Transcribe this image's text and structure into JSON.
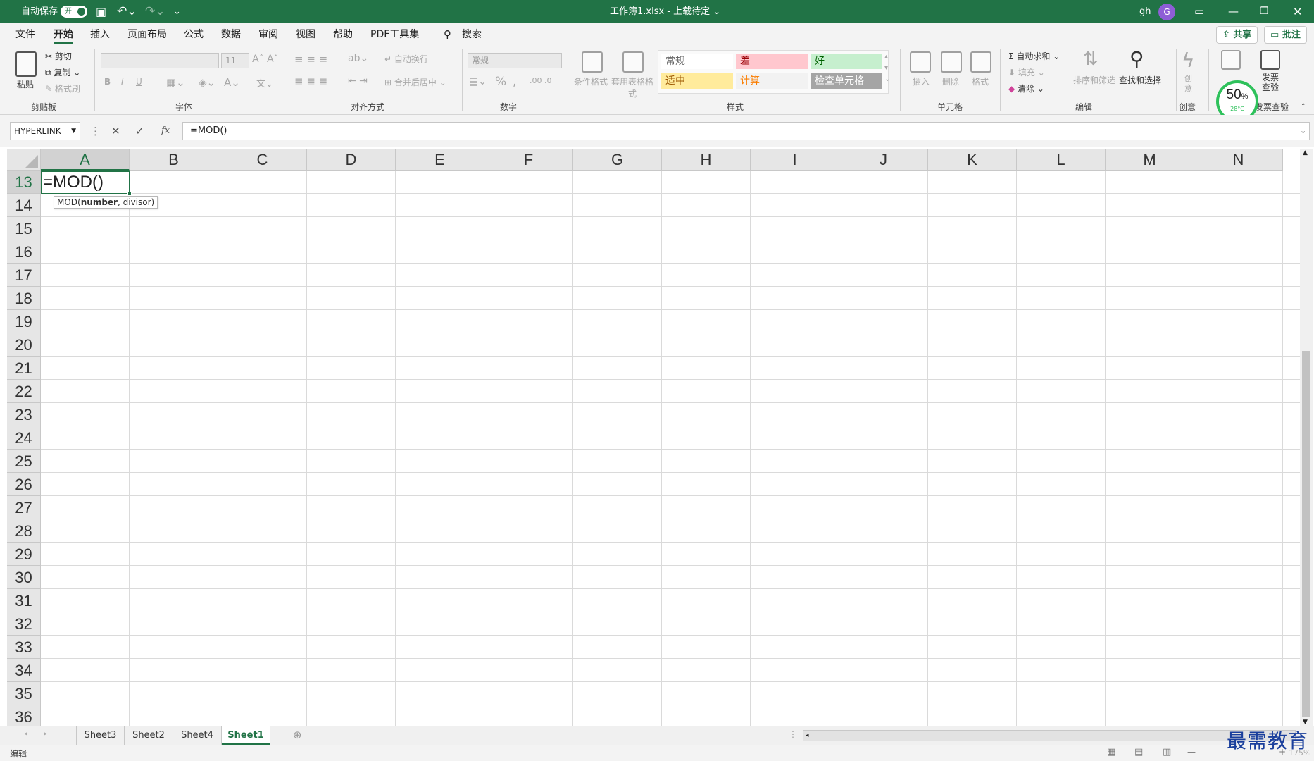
{
  "titlebar": {
    "autosave_label": "自动保存",
    "autosave_toggle": "开",
    "doc_title": "工作簿1.xlsx - 上载待定 ⌄",
    "user_name": "gh",
    "user_initial": "G"
  },
  "menu": {
    "tabs": [
      "文件",
      "开始",
      "插入",
      "页面布局",
      "公式",
      "数据",
      "审阅",
      "视图",
      "帮助",
      "PDF工具集"
    ],
    "active": "开始",
    "search": "搜索",
    "share": "共享",
    "comment": "批注"
  },
  "ribbon": {
    "clipboard": {
      "paste": "粘贴",
      "cut": "剪切",
      "copy": "复制",
      "format_painter": "格式刷",
      "label": "剪贴板"
    },
    "font": {
      "size": "11",
      "label": "字体",
      "bold": "B",
      "italic": "I",
      "underline": "U"
    },
    "alignment": {
      "wrap": "自动换行",
      "merge": "合并后居中",
      "label": "对齐方式"
    },
    "number": {
      "format": "常规",
      "label": "数字"
    },
    "styles": {
      "conditional": "条件格式",
      "table": "套用表格格式",
      "cells": [
        {
          "text": "常规",
          "bg": "#ffffff",
          "color": "#666666"
        },
        {
          "text": "差",
          "bg": "#ffc7ce",
          "color": "#9c0006"
        },
        {
          "text": "好",
          "bg": "#c6efce",
          "color": "#006100"
        },
        {
          "text": "适中",
          "bg": "#ffeb9c",
          "color": "#9c5700"
        },
        {
          "text": "计算",
          "bg": "#f2f2f2",
          "color": "#fa7d00"
        },
        {
          "text": "检查单元格",
          "bg": "#a5a5a5",
          "color": "#ffffff"
        }
      ],
      "label": "样式"
    },
    "cells_group": {
      "insert": "插入",
      "delete": "删除",
      "format": "格式",
      "label": "单元格"
    },
    "editing": {
      "autosum": "自动求和",
      "fill": "填充",
      "clear": "清除",
      "sort": "排序和筛选",
      "find": "查找和选择",
      "label": "编辑"
    },
    "creative": {
      "label": "创意",
      "btn": "创意"
    },
    "invoice": {
      "btn": "发票查验",
      "label": "发票查验"
    },
    "gauge": {
      "percent": "50",
      "temp": "28°C"
    }
  },
  "formula_bar": {
    "name_box": "HYPERLINK",
    "cancel": "✕",
    "enter": "✓",
    "fx": "fx",
    "formula": "=MOD()"
  },
  "grid": {
    "columns": [
      "A",
      "B",
      "C",
      "D",
      "E",
      "F",
      "G",
      "H",
      "I",
      "J",
      "K",
      "L",
      "M",
      "N"
    ],
    "rows": [
      "13",
      "14",
      "15",
      "16",
      "17",
      "18",
      "19",
      "20",
      "21",
      "22",
      "23",
      "24",
      "25",
      "26",
      "27",
      "28",
      "29",
      "30",
      "31",
      "32",
      "33",
      "34",
      "35",
      "36"
    ],
    "selected_column": "A",
    "selected_row": "13",
    "active_cell_value": "=MOD()",
    "tooltip_fn": "MOD(",
    "tooltip_arg1": "number",
    "tooltip_rest": ", divisor)"
  },
  "sheets": {
    "tabs": [
      "Sheet3",
      "Sheet2",
      "Sheet4",
      "Sheet1"
    ],
    "active": "Sheet1"
  },
  "status": {
    "mode": "编辑",
    "zoom": "175%"
  },
  "watermark": "最需教育",
  "colors": {
    "accent": "#217346"
  }
}
